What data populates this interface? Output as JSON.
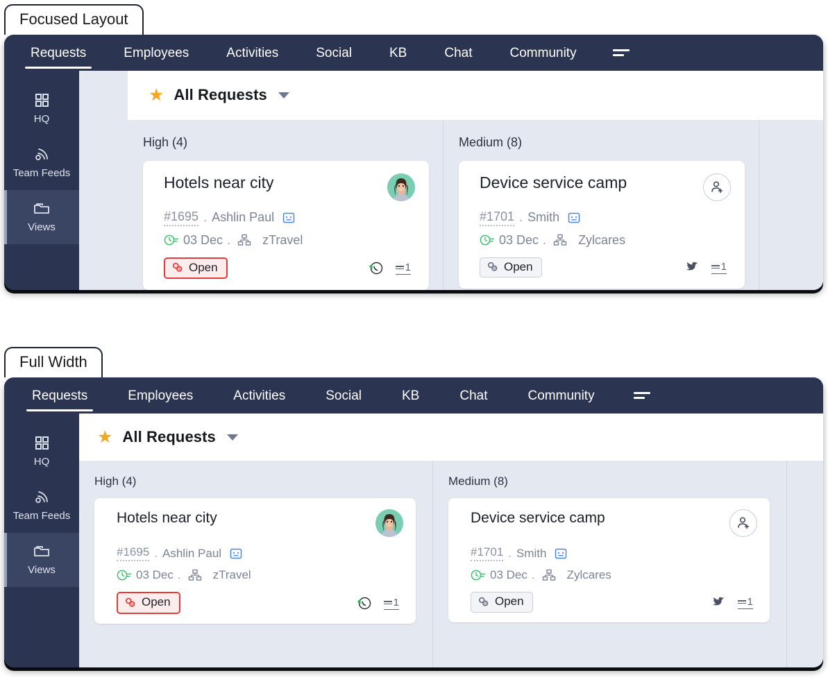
{
  "panels": [
    {
      "label": "Focused Layout",
      "variant": "focused",
      "nav": {
        "items": [
          {
            "label": "Requests",
            "active": true
          },
          {
            "label": "Employees",
            "active": false
          },
          {
            "label": "Activities",
            "active": false
          },
          {
            "label": "Social",
            "active": false
          },
          {
            "label": "KB",
            "active": false
          },
          {
            "label": "Chat",
            "active": false
          },
          {
            "label": "Community",
            "active": false
          }
        ],
        "menu_icon": "align-left-icon"
      },
      "sidebar": {
        "items": [
          {
            "label": "HQ",
            "icon": "grid-icon",
            "active": false
          },
          {
            "label": "Team Feeds",
            "icon": "rss-icon",
            "active": false
          },
          {
            "label": "Views",
            "icon": "folder-icon",
            "active": true
          }
        ]
      },
      "view_header": {
        "star_icon": "star-icon",
        "title": "All Requests",
        "caret_icon": "chevron-down-icon"
      },
      "columns": [
        {
          "title": "High (4)",
          "card": {
            "title": "Hotels near city",
            "ticket_id": "#1695",
            "separator": ".",
            "requester": "Ashlin Paul",
            "chat_icon": "chat-box-icon",
            "due_icon": "clock-icon",
            "due_date": "03 Dec",
            "due_separator": ".",
            "org_icon": "org-chart-icon",
            "org": "zTravel",
            "status": "Open",
            "status_icon": "link-icon",
            "status_style": "red",
            "channel_icon": "whatsapp-icon",
            "thread_count": "1",
            "avatar_type": "photo"
          }
        },
        {
          "title": "Medium (8)",
          "card": {
            "title": "Device service camp",
            "ticket_id": "#1701",
            "separator": ".",
            "requester": "Smith",
            "chat_icon": "chat-box-icon",
            "due_icon": "clock-icon",
            "due_date": "03 Dec",
            "due_separator": ".",
            "org_icon": "org-chart-icon",
            "org": "Zylcares",
            "status": "Open",
            "status_icon": "link-icon",
            "status_style": "gray",
            "channel_icon": "twitter-icon",
            "thread_count": "1",
            "avatar_type": "add-user"
          }
        }
      ]
    },
    {
      "label": "Full Width",
      "variant": "full",
      "nav": {
        "items": [
          {
            "label": "Requests",
            "active": true
          },
          {
            "label": "Employees",
            "active": false
          },
          {
            "label": "Activities",
            "active": false
          },
          {
            "label": "Social",
            "active": false
          },
          {
            "label": "KB",
            "active": false
          },
          {
            "label": "Chat",
            "active": false
          },
          {
            "label": "Community",
            "active": false
          }
        ],
        "menu_icon": "align-left-icon"
      },
      "sidebar": {
        "items": [
          {
            "label": "HQ",
            "icon": "grid-icon",
            "active": false
          },
          {
            "label": "Team Feeds",
            "icon": "rss-icon",
            "active": false
          },
          {
            "label": "Views",
            "icon": "folder-icon",
            "active": true
          }
        ]
      },
      "view_header": {
        "star_icon": "star-icon",
        "title": "All Requests",
        "caret_icon": "chevron-down-icon"
      },
      "columns": [
        {
          "title": "High (4)",
          "card": {
            "title": "Hotels near city",
            "ticket_id": "#1695",
            "separator": ".",
            "requester": "Ashlin Paul",
            "chat_icon": "chat-box-icon",
            "due_icon": "clock-icon",
            "due_date": "03 Dec",
            "due_separator": ".",
            "org_icon": "org-chart-icon",
            "org": "zTravel",
            "status": "Open",
            "status_icon": "link-icon",
            "status_style": "red",
            "channel_icon": "whatsapp-icon",
            "thread_count": "1",
            "avatar_type": "photo"
          }
        },
        {
          "title": "Medium (8)",
          "card": {
            "title": "Device service camp",
            "ticket_id": "#1701",
            "separator": ".",
            "requester": "Smith",
            "chat_icon": "chat-box-icon",
            "due_icon": "clock-icon",
            "due_date": "03 Dec",
            "due_separator": ".",
            "org_icon": "org-chart-icon",
            "org": "Zylcares",
            "status": "Open",
            "status_icon": "link-icon",
            "status_style": "gray",
            "channel_icon": "twitter-icon",
            "thread_count": "1",
            "avatar_type": "add-user"
          }
        }
      ]
    }
  ],
  "colors": {
    "nav_background": "#2b3552",
    "content_background": "#e4e8f1",
    "card_background": "#ffffff",
    "star": "#f5a623",
    "status_open_red": "#e23b3b",
    "due_clock_green": "#3fbf6f",
    "avatar_background": "#79ceb2",
    "sidebar_active": "#3a4463"
  }
}
